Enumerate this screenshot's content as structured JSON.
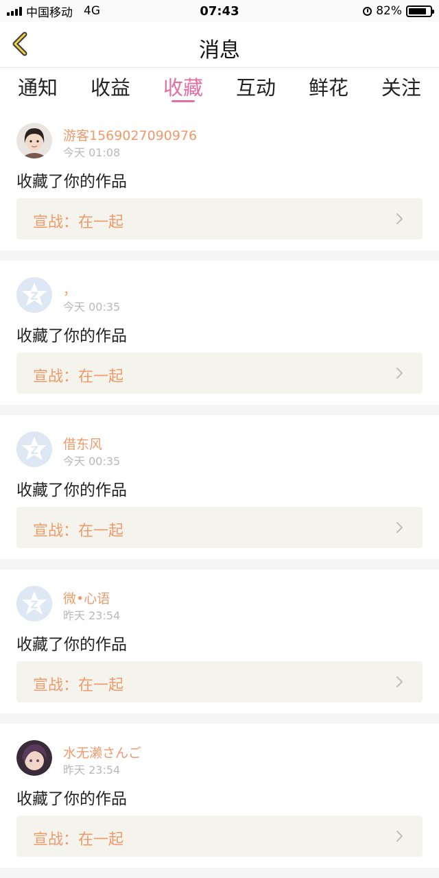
{
  "status_bar": {
    "carrier": "中国移动",
    "network": "4G",
    "time": "07:43",
    "battery_text": "82%",
    "battery_level": 0.82
  },
  "nav": {
    "title": "消息",
    "back_icon": "chevron-left-icon"
  },
  "tabs": [
    {
      "label": "通知",
      "active": false
    },
    {
      "label": "收益",
      "active": false
    },
    {
      "label": "收藏",
      "active": true
    },
    {
      "label": "互动",
      "active": false
    },
    {
      "label": "鲜花",
      "active": false
    },
    {
      "label": "关注",
      "active": false
    }
  ],
  "colors": {
    "accent": "#e56fa2",
    "username": "#ef9a6a",
    "card_bg": "#f5f4ec"
  },
  "messages": [
    {
      "user": "游客1569027090976",
      "time": "今天 01:08",
      "action": "收藏了你的作品",
      "work": "宣战：在一起",
      "avatar": "photo"
    },
    {
      "user": "，",
      "time": "今天 00:35",
      "action": "收藏了你的作品",
      "work": "宣战：在一起",
      "avatar": "default"
    },
    {
      "user": "借东风",
      "time": "今天 00:35",
      "action": "收藏了你的作品",
      "work": "宣战：在一起",
      "avatar": "default"
    },
    {
      "user": "微•心语",
      "time": "昨天 23:54",
      "action": "收藏了你的作品",
      "work": "宣战：在一起",
      "avatar": "default"
    },
    {
      "user": "水无濑さんご",
      "time": "昨天 23:54",
      "action": "收藏了你的作品",
      "work": "宣战：在一起",
      "avatar": "photo2"
    }
  ]
}
